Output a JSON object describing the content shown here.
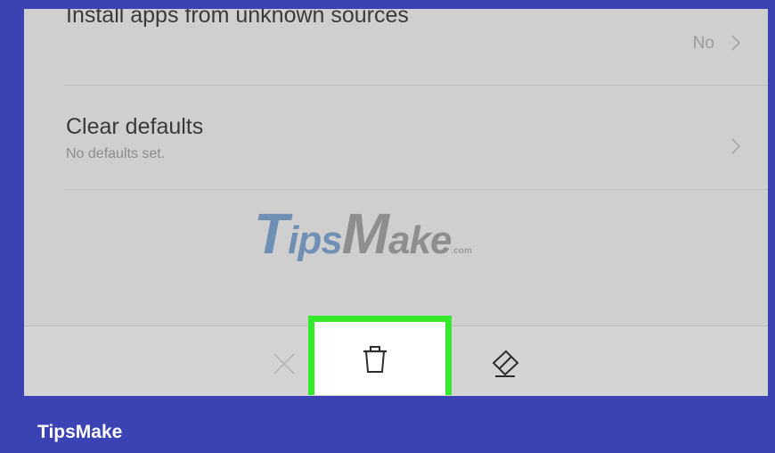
{
  "settings": {
    "unknown_sources": {
      "label": "Install apps from unknown sources",
      "value": "No"
    },
    "clear_defaults": {
      "label": "Clear defaults",
      "subtitle": "No defaults set."
    }
  },
  "watermark": {
    "t": "T",
    "ips": "ips",
    "m": "M",
    "ake": "ake",
    "com": ".com"
  },
  "toolbar": {
    "buttons": [
      "close-icon",
      "trash-icon",
      "eraser-icon"
    ]
  },
  "footer": {
    "brand": "TipsMake"
  },
  "colors": {
    "frame": "#3a42b4",
    "highlight": "#35ea2a"
  }
}
